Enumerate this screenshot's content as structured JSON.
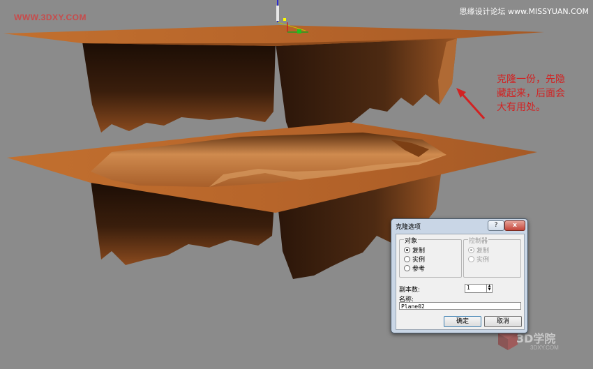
{
  "watermark_left": "WWW.3DXY.COM",
  "watermark_right": "思缘设计论坛 www.MISSYUAN.COM",
  "annotation": [
    "克隆一份，先隐",
    "藏起来，后面会",
    "大有用处。"
  ],
  "brand": {
    "name": "3D学院",
    "sub": "3DXY.COM"
  },
  "colors": {
    "terrain": "#b8662a",
    "terrain_dark": "#2a1508",
    "annotation": "#d22222"
  },
  "dialog": {
    "title": "克隆选项",
    "help_label": "?",
    "close_label": "x",
    "object_group": {
      "label": "对象",
      "options": [
        "复制",
        "实例",
        "参考"
      ],
      "selected": "复制"
    },
    "controller_group": {
      "label": "控制器",
      "options": [
        "复制",
        "实例"
      ],
      "selected": "复制",
      "disabled": true
    },
    "copies_label": "副本数:",
    "copies_value": "1",
    "name_label": "名称:",
    "name_value": "Plane02",
    "ok_label": "确定",
    "cancel_label": "取消"
  }
}
